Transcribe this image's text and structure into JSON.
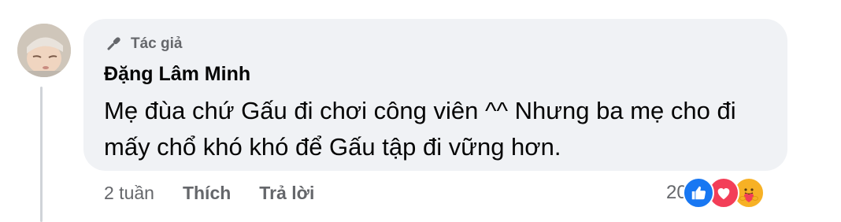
{
  "comment": {
    "author_badge": "Tác giả",
    "author_name": "Đặng Lâm Minh",
    "text": "Mẹ đùa chứ Gấu đi chơi công viên ^^ Nhưng ba mẹ cho đi mấy chổ khó khó để Gấu tập đi vững hơn."
  },
  "actions": {
    "time": "2 tuần",
    "like_label": "Thích",
    "reply_label": "Trả lời"
  },
  "reactions": {
    "count": "20",
    "types": [
      "like-icon",
      "love-icon",
      "care-icon"
    ]
  },
  "colors": {
    "bubble": "#f0f2f5",
    "secondary_text": "#65676b",
    "like_blue": "#1877f2",
    "love_red": "#f33e58",
    "care_yellow": "#f7b125"
  }
}
